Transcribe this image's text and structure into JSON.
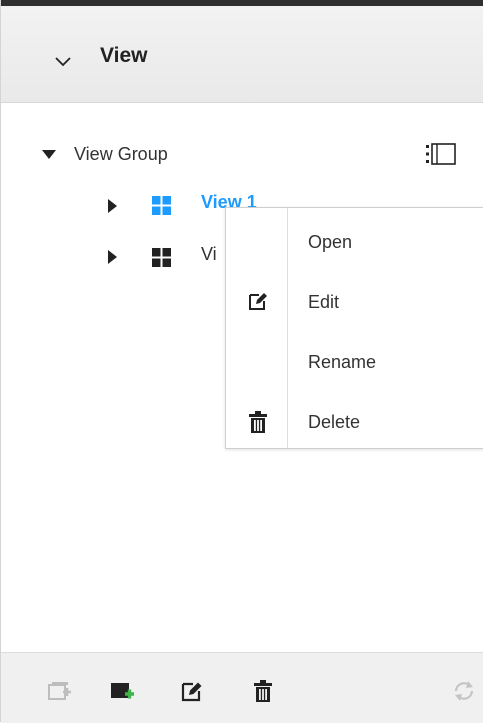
{
  "panel": {
    "title": "View"
  },
  "tree": {
    "group_label": "View Group",
    "views": [
      {
        "label": "View 1",
        "selected": true
      },
      {
        "label": "Vi",
        "selected": false
      }
    ]
  },
  "context_menu": {
    "items": [
      {
        "label": "Open",
        "icon": "none"
      },
      {
        "label": "Edit",
        "icon": "edit-icon"
      },
      {
        "label": "Rename",
        "icon": "none"
      },
      {
        "label": "Delete",
        "icon": "trash-icon"
      }
    ]
  },
  "footer": {
    "buttons": [
      "add-view-disabled-icon",
      "add-view-icon",
      "edit-icon",
      "delete-icon",
      "refresh-icon"
    ]
  },
  "colors": {
    "accent": "#1e9bff",
    "add_green": "#3db54a",
    "dark_icon": "#222222"
  }
}
